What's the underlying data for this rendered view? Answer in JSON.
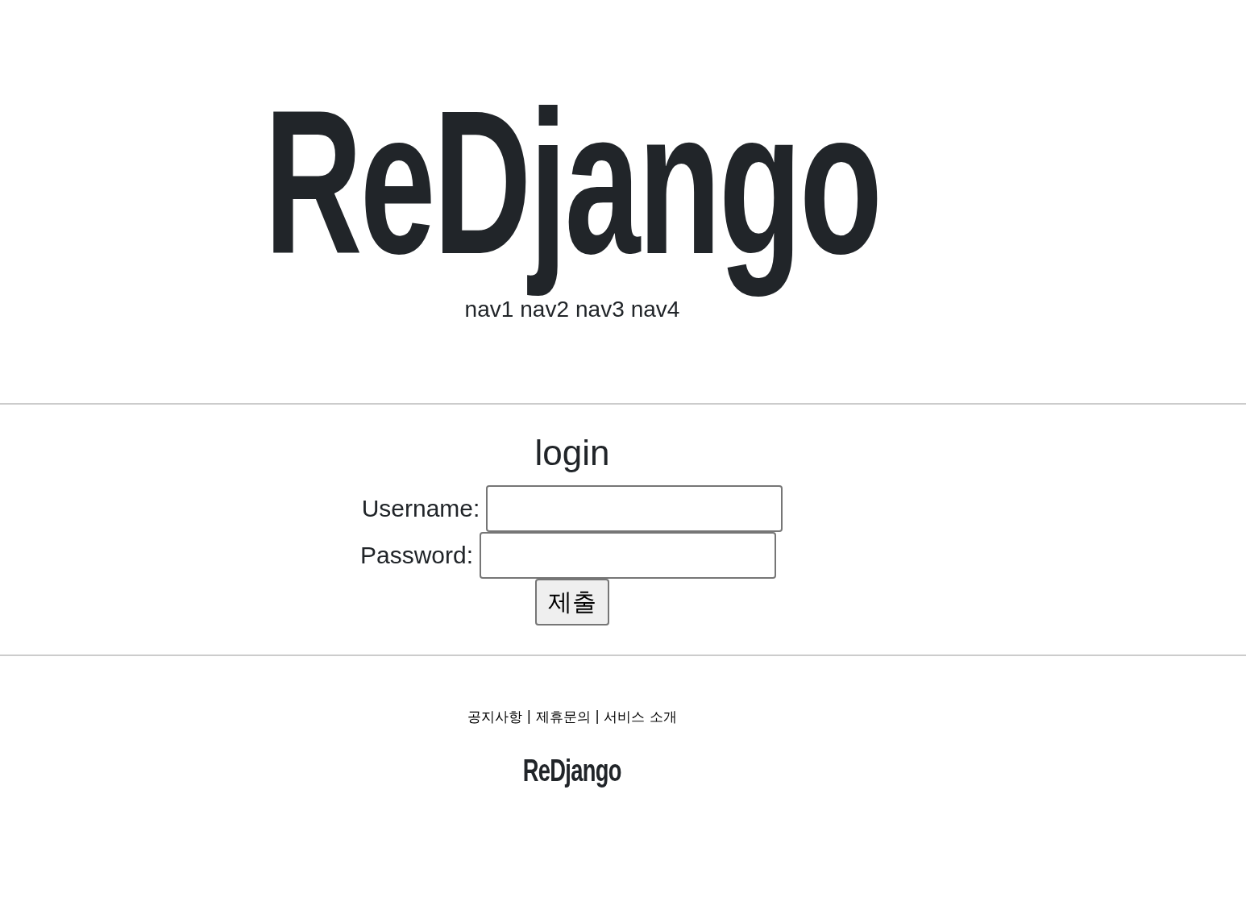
{
  "header": {
    "logo": "ReDjango",
    "nav": [
      {
        "label": "nav1"
      },
      {
        "label": "nav2"
      },
      {
        "label": "nav3"
      },
      {
        "label": "nav4"
      }
    ]
  },
  "login": {
    "title": "login",
    "fields": [
      {
        "label": "Username:"
      },
      {
        "label": "Password:"
      }
    ],
    "submit": "제출"
  },
  "footer": {
    "links": [
      {
        "kind": "link",
        "text": "공지사항"
      },
      {
        "kind": "separator",
        "text": "|"
      },
      {
        "kind": "link",
        "text": "제휴문의"
      },
      {
        "kind": "separator",
        "text": "|"
      },
      {
        "kind": "link",
        "text": "서비스 소개"
      }
    ],
    "logo": "ReDjango"
  }
}
